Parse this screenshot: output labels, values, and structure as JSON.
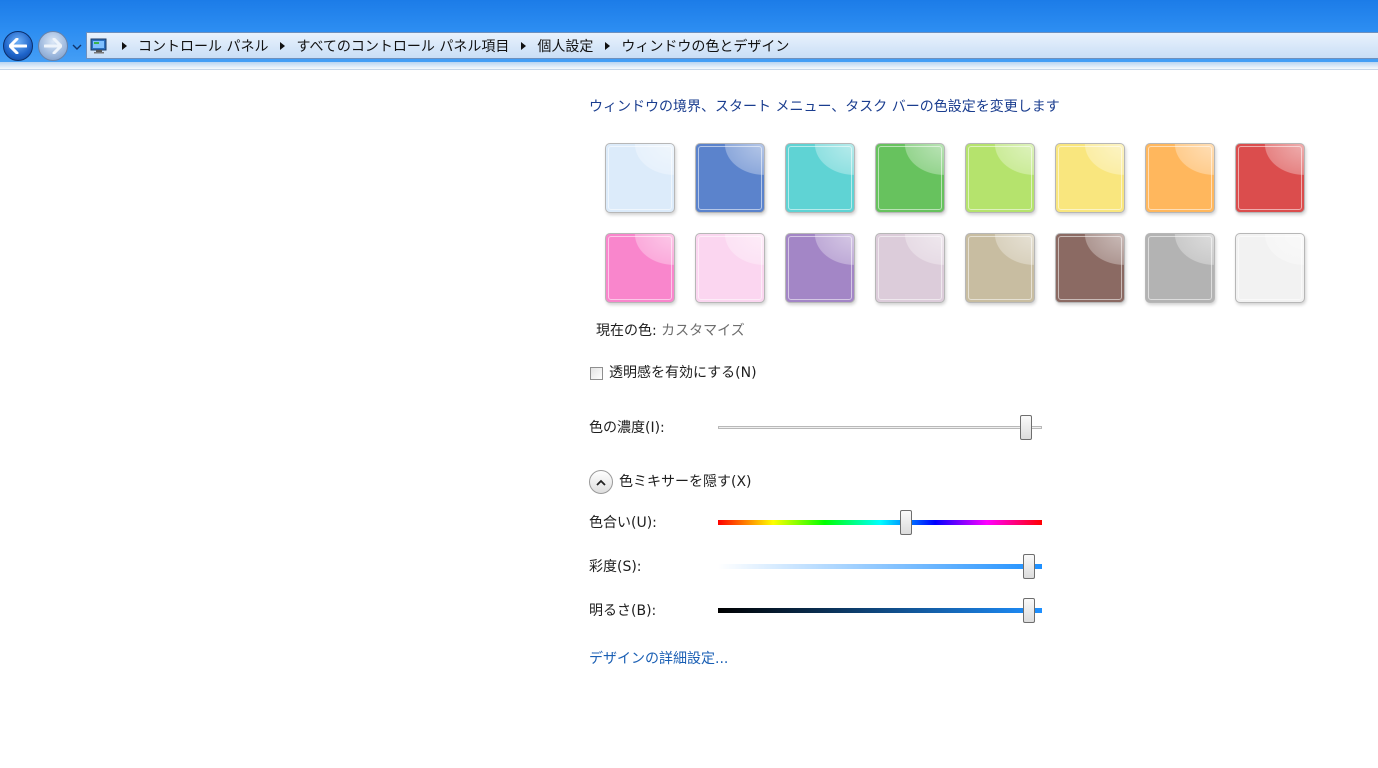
{
  "breadcrumb": {
    "items": [
      {
        "label": "コントロール パネル"
      },
      {
        "label": "すべてのコントロール パネル項目"
      },
      {
        "label": "個人設定"
      },
      {
        "label": "ウィンドウの色とデザイン"
      }
    ]
  },
  "heading": "ウィンドウの境界、スタート メニュー、タスク バーの色設定を変更します",
  "swatches": [
    {
      "color": "#dcebfa"
    },
    {
      "color": "#5b83cc"
    },
    {
      "color": "#5fd3d4"
    },
    {
      "color": "#67c25e"
    },
    {
      "color": "#b5e36d"
    },
    {
      "color": "#f9e67e"
    },
    {
      "color": "#ffb75d"
    },
    {
      "color": "#db4d4d"
    },
    {
      "color": "#f986cc"
    },
    {
      "color": "#fbd6f0"
    },
    {
      "color": "#a386c6"
    },
    {
      "color": "#dcccda"
    },
    {
      "color": "#c8bda1"
    },
    {
      "color": "#8b6a63"
    },
    {
      "color": "#b3b3b3"
    },
    {
      "color": "#f2f2f2"
    }
  ],
  "current_color": {
    "label": "現在の色:",
    "value": "カスタマイズ"
  },
  "transparency": {
    "label": "透明感を有効にする(N)",
    "checked": false
  },
  "intensity": {
    "label": "色の濃度(I):",
    "level": 0.95
  },
  "mixer": {
    "toggle_label": "色ミキサーを隠す(X)"
  },
  "hue": {
    "label": "色合い(U):",
    "level": 0.58
  },
  "saturation": {
    "label": "彩度(S):",
    "level": 0.96
  },
  "brightness": {
    "label": "明るさ(B):",
    "level": 0.96
  },
  "advanced_link": "デザインの詳細設定..."
}
